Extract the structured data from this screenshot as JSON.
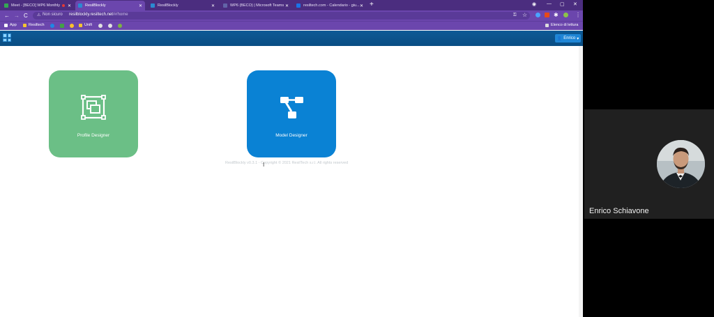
{
  "browser": {
    "tabs": [
      {
        "label": "Meet - [BECO] WP6 Monthly",
        "favicon_color": "#34a853",
        "recording": true,
        "active": false
      },
      {
        "label": "ResilBlockly",
        "favicon_color": "#2b8ad1",
        "recording": false,
        "active": true
      },
      {
        "label": "ResilBlockly",
        "favicon_color": "#2b8ad1",
        "recording": false,
        "active": false
      },
      {
        "label": "WP6 (BECO) | Microsoft Teams",
        "favicon_color": "#6264a7",
        "recording": false,
        "active": false
      },
      {
        "label": "resiltech.com - Calendario - giu...",
        "favicon_color": "#1a73e8",
        "recording": false,
        "active": false
      }
    ],
    "new_tab_label": "+",
    "window_controls": {
      "minimize": "—",
      "maximize": "▢",
      "close": "✕"
    },
    "nav": {
      "back": "←",
      "forward": "→",
      "reload": "C"
    },
    "address": {
      "security_label": "Non sicuro",
      "host": "resilblockly.resiltech.net",
      "path": "/#/home"
    },
    "bookmarks": {
      "apps_label": "App",
      "items": [
        "Resiltech",
        "Unifi"
      ],
      "reading_list_label": "Elenco di lettura"
    }
  },
  "app": {
    "user_label": "Enrico",
    "cards": [
      {
        "label": "Profile Designer",
        "color": "#6bbf86"
      },
      {
        "label": "Model Designer",
        "color": "#0a82d4"
      }
    ],
    "footer": "ResilBlockly v0.3.1 - Copyright © 2021 ResilTech s.r.l. All rights reserved"
  },
  "meeting": {
    "participant_name": "Enrico Schiavone"
  },
  "colors": {
    "tabstrip": "#4b2d7f",
    "toolbar": "#6b46ad",
    "appbar": "#0a4d83",
    "accent": "#1f86d6"
  }
}
